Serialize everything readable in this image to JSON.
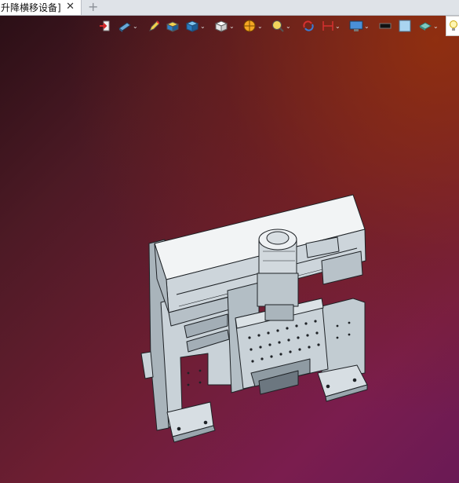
{
  "tab": {
    "title": "升降横移设备]",
    "close_glyph": "✕",
    "add_glyph": "+"
  },
  "toolbar": {
    "dropdown_glyph": "⌄",
    "icons": [
      "exit-icon",
      "view-orientation-icon",
      "pencil-icon",
      "shaded-cube-icon",
      "cube-view-icon",
      "white-cube-icon",
      "section-view-icon",
      "zoom-icon",
      "rotate-icon",
      "dimension-icon",
      "display-settings-icon",
      "black-color-icon",
      "light-blue-color-icon",
      "appearance-icon",
      "lightbulb-icon"
    ]
  },
  "colors": {
    "tab_bar": "#dfe3e8",
    "model_body": "#c9d2d8",
    "model_shadow": "#9aa6ae",
    "model_edge": "#1e2226"
  }
}
